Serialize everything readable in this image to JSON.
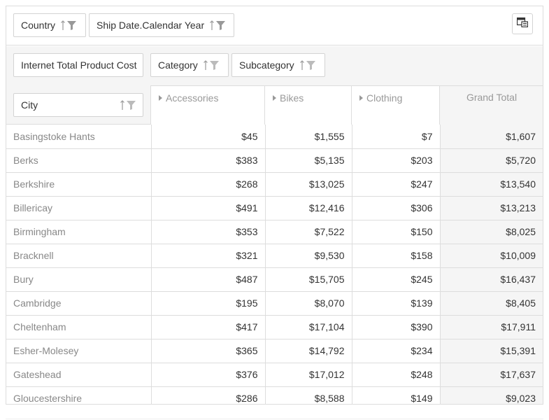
{
  "filter_fields": [
    {
      "label": "Country"
    },
    {
      "label": "Ship Date.Calendar Year"
    }
  ],
  "data_field": {
    "label": "Internet Total Product Cost"
  },
  "column_fields": [
    {
      "label": "Category"
    },
    {
      "label": "Subcategory"
    }
  ],
  "row_field": {
    "label": "City"
  },
  "columns": [
    "Accessories",
    "Bikes",
    "Clothing"
  ],
  "grand_total_label": "Grand Total",
  "rows": [
    {
      "city": "Basingstoke Hants",
      "accessories": "$45",
      "bikes": "$1,555",
      "clothing": "$7",
      "total": "$1,607"
    },
    {
      "city": "Berks",
      "accessories": "$383",
      "bikes": "$5,135",
      "clothing": "$203",
      "total": "$5,720"
    },
    {
      "city": "Berkshire",
      "accessories": "$268",
      "bikes": "$13,025",
      "clothing": "$247",
      "total": "$13,540"
    },
    {
      "city": "Billericay",
      "accessories": "$491",
      "bikes": "$12,416",
      "clothing": "$306",
      "total": "$13,213"
    },
    {
      "city": "Birmingham",
      "accessories": "$353",
      "bikes": "$7,522",
      "clothing": "$150",
      "total": "$8,025"
    },
    {
      "city": "Bracknell",
      "accessories": "$321",
      "bikes": "$9,530",
      "clothing": "$158",
      "total": "$10,009"
    },
    {
      "city": "Bury",
      "accessories": "$487",
      "bikes": "$15,705",
      "clothing": "$245",
      "total": "$16,437"
    },
    {
      "city": "Cambridge",
      "accessories": "$195",
      "bikes": "$8,070",
      "clothing": "$139",
      "total": "$8,405"
    },
    {
      "city": "Cheltenham",
      "accessories": "$417",
      "bikes": "$17,104",
      "clothing": "$390",
      "total": "$17,911"
    },
    {
      "city": "Esher-Molesey",
      "accessories": "$365",
      "bikes": "$14,792",
      "clothing": "$234",
      "total": "$15,391"
    },
    {
      "city": "Gateshead",
      "accessories": "$376",
      "bikes": "$17,012",
      "clothing": "$248",
      "total": "$17,637"
    },
    {
      "city": "Gloucestershire",
      "accessories": "$286",
      "bikes": "$8,588",
      "clothing": "$149",
      "total": "$9,023"
    }
  ],
  "icons": {
    "sort": "sort-ascending-icon",
    "filter": "filter-funnel-icon",
    "expand": "expand-triangle-icon",
    "field_chooser": "field-chooser-icon"
  },
  "colors": {
    "border": "#dddddd",
    "header_bg": "#f5f5f5",
    "icon": "#999999",
    "muted_text": "#999999"
  }
}
